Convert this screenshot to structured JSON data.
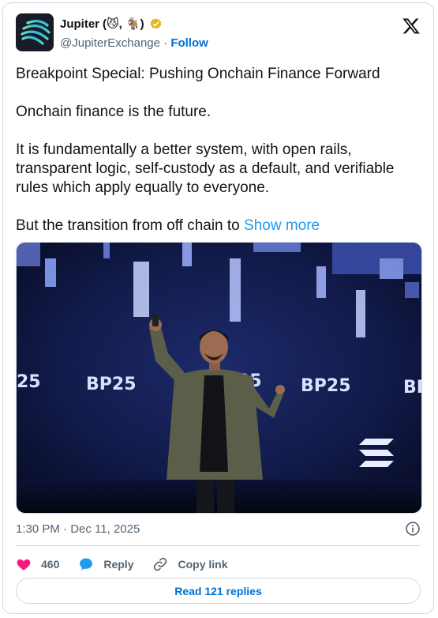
{
  "author": {
    "name": "Jupiter",
    "name_suffix": "(😼, 🐐)",
    "handle": "@JupiterExchange",
    "separator": "·",
    "follow_label": "Follow",
    "verified_color": "#e2b719"
  },
  "tweet": {
    "paragraphs": [
      "Breakpoint Special: Pushing Onchain Finance Forward",
      "Onchain finance is the future.",
      "It is fundamentally a better system, with open rails, transparent logic, self-custody as a default, and verifiable rules which apply equally to everyone."
    ],
    "truncated_text": "But the transition from off chain to",
    "show_more_label": "Show more"
  },
  "media": {
    "stage_text": [
      "25",
      "BP25",
      "BP25",
      "25",
      "BP25"
    ]
  },
  "timestamp": "1:30 PM · Dec 11, 2025",
  "actions": {
    "like_count": "460",
    "reply_label": "Reply",
    "copy_link_label": "Copy link"
  },
  "read_replies_label": "Read 121 replies",
  "colors": {
    "like": "#f91880",
    "reply": "#1d9bf0",
    "link": "#006fd6",
    "muted": "#536471"
  },
  "icons": [
    "avatar-logo",
    "verified-badge-icon",
    "x-logo-icon",
    "info-icon",
    "heart-icon",
    "reply-bubble-icon",
    "link-icon"
  ]
}
